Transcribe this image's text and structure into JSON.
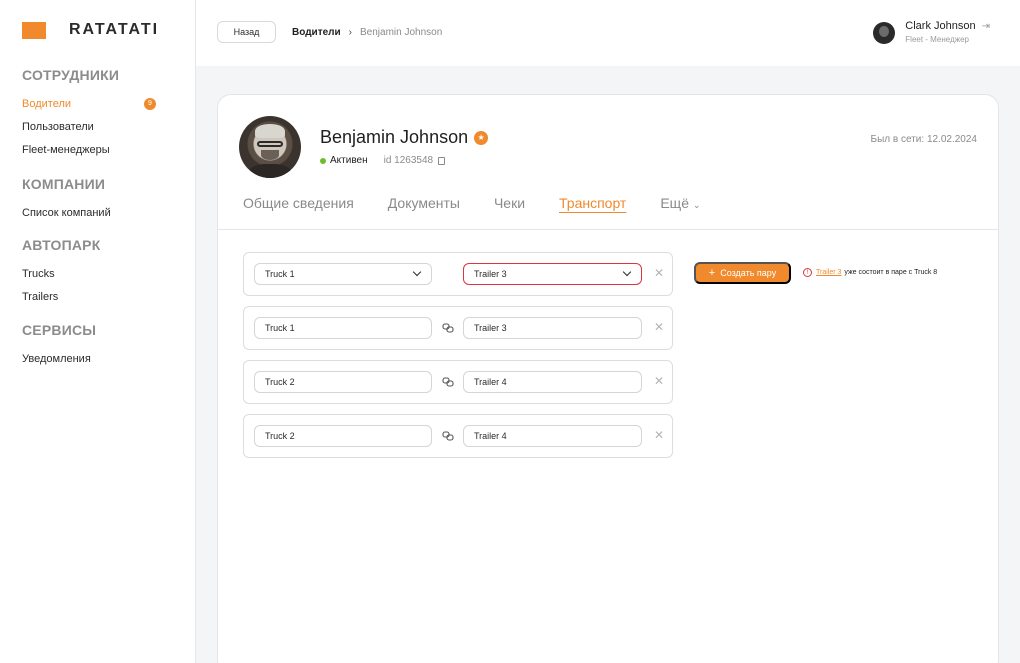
{
  "logo": {
    "text": "RATATATI"
  },
  "sidebar": {
    "sections": [
      {
        "heading": "СОТРУДНИКИ",
        "items": [
          {
            "label": "Водители",
            "badge": "9",
            "active": true
          },
          {
            "label": "Пользователи"
          },
          {
            "label": "Fleet-менеджеры"
          }
        ]
      },
      {
        "heading": "КОМПАНИИ",
        "items": [
          {
            "label": "Список компаний"
          }
        ]
      },
      {
        "heading": "АВТОПАРК",
        "items": [
          {
            "label": "Trucks"
          },
          {
            "label": "Trailers"
          }
        ]
      },
      {
        "heading": "СЕРВИСЫ",
        "items": [
          {
            "label": "Уведомления"
          }
        ]
      }
    ]
  },
  "topbar": {
    "back_label": "Назад",
    "breadcrumb": [
      "Водители",
      "Benjamin Johnson"
    ],
    "user": {
      "name": "Clark Johnson",
      "role": "Fleet - Менеджер"
    }
  },
  "profile": {
    "name": "Benjamin Johnson",
    "status": "Активен",
    "id_text": "id 1263548",
    "last_seen": "Был в сети: 12.02.2024"
  },
  "tabs": [
    {
      "label": "Общие сведения"
    },
    {
      "label": "Документы"
    },
    {
      "label": "Чеки"
    },
    {
      "label": "Транспорт",
      "active": true
    },
    {
      "label": "Ещё",
      "dropdown": true
    }
  ],
  "pairs": [
    {
      "truck": "Truck 1",
      "trailer": "Trailer 3",
      "editable": true,
      "trailer_error": true
    },
    {
      "truck": "Truck 1",
      "trailer": "Trailer 3"
    },
    {
      "truck": "Truck 2",
      "trailer": "Trailer 4"
    },
    {
      "truck": "Truck 2",
      "trailer": "Trailer 4"
    }
  ],
  "actions": {
    "create_pair_label": "Создать пару",
    "notice_link": "Trailer 3",
    "notice_text": "уже состоит в паре с Truck 8"
  },
  "colors": {
    "accent": "#f08a2c",
    "error": "#d9363e",
    "status_active": "#6cbf2a"
  }
}
